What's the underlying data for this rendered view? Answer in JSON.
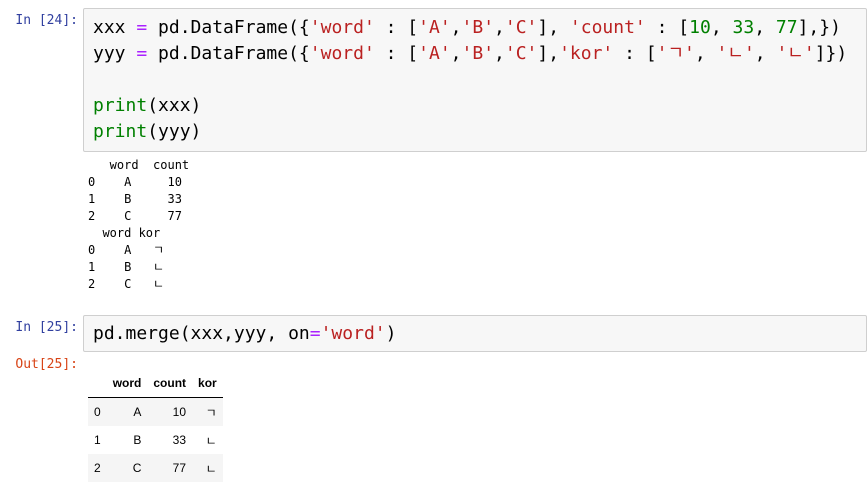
{
  "cells": [
    {
      "prompt": "In [24]:",
      "code_lines": [
        [
          [
            "xxx ",
            ""
          ],
          [
            "=",
            "op"
          ],
          [
            " pd.DataFrame({",
            ""
          ],
          [
            "'word'",
            "st"
          ],
          [
            " : [",
            ""
          ],
          [
            "'A'",
            "st"
          ],
          [
            ",",
            ""
          ],
          [
            "'B'",
            "st"
          ],
          [
            ",",
            ""
          ],
          [
            "'C'",
            "st"
          ],
          [
            "], ",
            ""
          ],
          [
            "'count'",
            "st"
          ],
          [
            " : [",
            ""
          ],
          [
            "10",
            "nm"
          ],
          [
            ", ",
            ""
          ],
          [
            "33",
            "nm"
          ],
          [
            ", ",
            ""
          ],
          [
            "77",
            "nm"
          ],
          [
            "],})",
            ""
          ]
        ],
        [
          [
            "yyy ",
            ""
          ],
          [
            "=",
            "op"
          ],
          [
            " pd.DataFrame({",
            ""
          ],
          [
            "'word'",
            "st"
          ],
          [
            " : [",
            ""
          ],
          [
            "'A'",
            "st"
          ],
          [
            ",",
            ""
          ],
          [
            "'B'",
            "st"
          ],
          [
            ",",
            ""
          ],
          [
            "'C'",
            "st"
          ],
          [
            "],",
            ""
          ],
          [
            "'kor'",
            "st"
          ],
          [
            " : [",
            ""
          ],
          [
            "'ㄱ'",
            "st"
          ],
          [
            ", ",
            ""
          ],
          [
            "'ㄴ'",
            "st"
          ],
          [
            ", ",
            ""
          ],
          [
            "'ㄴ'",
            "st"
          ],
          [
            "]})",
            ""
          ]
        ],
        [],
        [
          [
            "print",
            "kw"
          ],
          [
            "(xxx)",
            ""
          ]
        ],
        [
          [
            "print",
            "kw"
          ],
          [
            "(yyy)",
            ""
          ]
        ]
      ],
      "stdout": "   word  count\n0    A     10\n1    B     33\n2    C     77\n  word kor\n0    A   ㄱ\n1    B   ㄴ\n2    C   ㄴ"
    },
    {
      "prompt": "In [25]:",
      "code_lines": [
        [
          [
            "pd.merge(xxx,yyy, on",
            ""
          ],
          [
            "=",
            "op"
          ],
          [
            "'word'",
            "st"
          ],
          [
            ")",
            ""
          ]
        ]
      ],
      "out_prompt": "Out[25]:",
      "table": {
        "columns": [
          "",
          "word",
          "count",
          "kor"
        ],
        "rows": [
          [
            "0",
            "A",
            "10",
            "ㄱ"
          ],
          [
            "1",
            "B",
            "33",
            "ㄴ"
          ],
          [
            "2",
            "C",
            "77",
            "ㄴ"
          ]
        ]
      }
    }
  ]
}
